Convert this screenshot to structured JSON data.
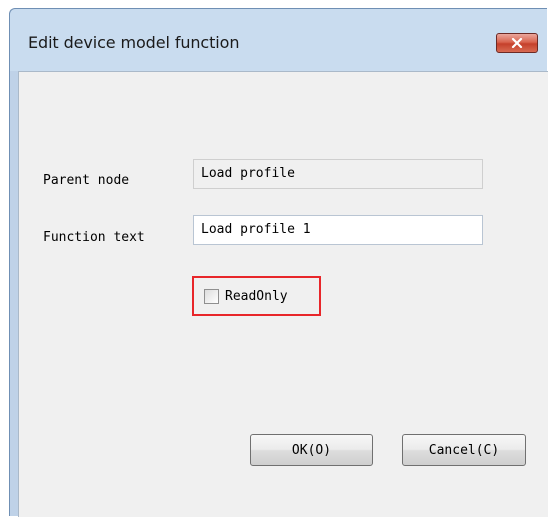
{
  "dialog": {
    "title": "Edit device model function",
    "close_icon": "close-x-icon",
    "fields": {
      "parent_node_label": "Parent node",
      "parent_node_value": "Load profile",
      "function_text_label": "Function text",
      "function_text_value": "Load profile 1"
    },
    "readonly_checkbox": {
      "label": "ReadOnly",
      "checked": false
    },
    "buttons": {
      "ok_label": "OK(O)",
      "cancel_label": "Cancel(C)"
    },
    "colors": {
      "highlight_border": "#e8262a",
      "close_button": "#c5402b"
    }
  }
}
